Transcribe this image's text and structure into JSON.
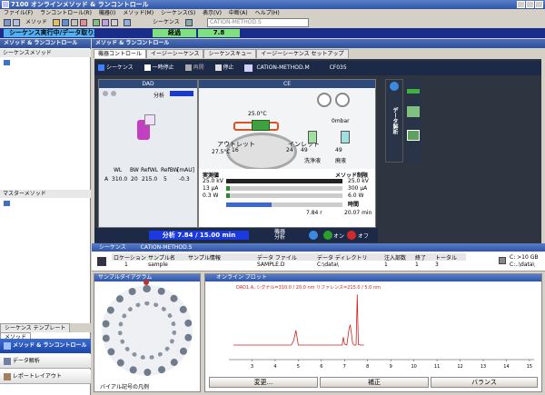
{
  "app": {
    "title": "7100 オンラインメソッド & ランコントロール"
  },
  "menu": [
    "ファイル(F)",
    "ランコントロール(R)",
    "機器(I)",
    "メソッド(M)",
    "シーケンス(S)",
    "表示(V)",
    "中断(A)",
    "ヘルプ(H)"
  ],
  "toolbar": {
    "method_label": "メソッド",
    "sequence_label": "シーケンス",
    "method_value": "CATION-METHOD.S"
  },
  "status": {
    "running": "シーケンス実行中/データ取り込み",
    "elapsed_label": "経過",
    "elapsed_value": "7.8"
  },
  "left": {
    "header": "メソッド & ランコントロール",
    "sequence_method_label": "シーケンスメソッド",
    "master_method_label": "マスターメソッド",
    "tabs": [
      "シーケンス テンプレート",
      "メソッド"
    ],
    "nav": [
      "メソッド & ランコントロール",
      "データ解析",
      "レポートレイアウト"
    ]
  },
  "main": {
    "header": "メソッド & ランコントロール",
    "tabs": [
      "機器コントロール",
      "イージーシーケンス",
      "シーケンスキュー",
      "イージーシーケンス セットアップ"
    ],
    "seq_label": "シーケンス",
    "pause_label": "一時停止",
    "resume_label": "再開",
    "stop_label": "停止",
    "method_file": "CATION-METHOD.M",
    "instrument_id": "CF035"
  },
  "dad": {
    "title": "DAD",
    "analysis_label": "分析",
    "headers": [
      "WL",
      "BW",
      "RefWL",
      "RefBW",
      "[mAU]"
    ],
    "row": [
      "A",
      "310.0",
      "20",
      "215.0",
      "5",
      "-0.3"
    ]
  },
  "ce": {
    "title": "CE",
    "temp1": "25.0°C",
    "temp2": "27.5°C",
    "pressure": "0mbar",
    "outlet_label": "アウトレット",
    "inlet_label": "インレット",
    "outlet_vial": "16",
    "inlet_vial": "24",
    "vial2": "49",
    "vial3": "49",
    "wash_label": "洗浄液",
    "waste_label": "廃液"
  },
  "meas": {
    "actual_label": "実測値",
    "limit_label": "メソッド制限",
    "rows": [
      {
        "actual": "25.0 kV",
        "limit": "25.0 kV"
      },
      {
        "actual": "13 µA",
        "limit": "300 µA"
      },
      {
        "actual": "0.3 W",
        "limit": "6.0 W"
      }
    ],
    "time_label": "時間",
    "time_current": "7.84 r",
    "time_total": "20.07 min"
  },
  "run": {
    "status": "分析 7.84 / 15.00 min",
    "instrument_status_1": "機器",
    "instrument_status_2": "分析",
    "on": "オン",
    "off": "オフ"
  },
  "side": {
    "label": "データ解析"
  },
  "sequence": {
    "header": "シーケンス",
    "method": "CATION-METHOD.S",
    "columns": [
      "ロケーション",
      "サンプル名",
      "サンプル情報",
      "データ ファイル",
      "データ ディレクトリ",
      "注入部数",
      "終了",
      "トータル"
    ],
    "row": [
      "1",
      "sample",
      "",
      "SAMPLE.D",
      "C:\\data\\",
      "1",
      "1",
      "3"
    ],
    "disk_1": "C: >10 GB",
    "disk_2": "C:..\\data\\"
  },
  "tray": {
    "header": "サンプルダイアグラム",
    "legend": "バイアル記号の凡例"
  },
  "plot": {
    "header": "オンライン プロット",
    "trace_label": "DAD1 A, シグナル=310.0 / 20.0 nm リファレンス=215.0 / 5.0 nm",
    "xticks": [
      "3",
      "4",
      "5",
      "6",
      "7",
      "8",
      "9",
      "10",
      "11",
      "12",
      "13",
      "14",
      "15"
    ],
    "change_button": "変更...",
    "adjust_button": "補正",
    "balance_button": "バランス"
  },
  "chart_data": {
    "type": "line",
    "title": "",
    "xlabel": "",
    "ylabel": "",
    "xlim": [
      2,
      15.2
    ],
    "x": [
      2.2,
      3,
      4,
      4.7,
      4.8,
      4.9,
      5,
      6,
      6.9,
      6.95,
      7,
      7.1,
      7.2,
      7.25,
      7.35,
      7.4,
      7.5,
      7.55,
      7.6,
      7.7,
      7.84
    ],
    "values": [
      0,
      0,
      0,
      0,
      8,
      26,
      0,
      0,
      0,
      14,
      2,
      0,
      30,
      36,
      4,
      0,
      0,
      90,
      1,
      0,
      0
    ],
    "color": "#d02020"
  }
}
